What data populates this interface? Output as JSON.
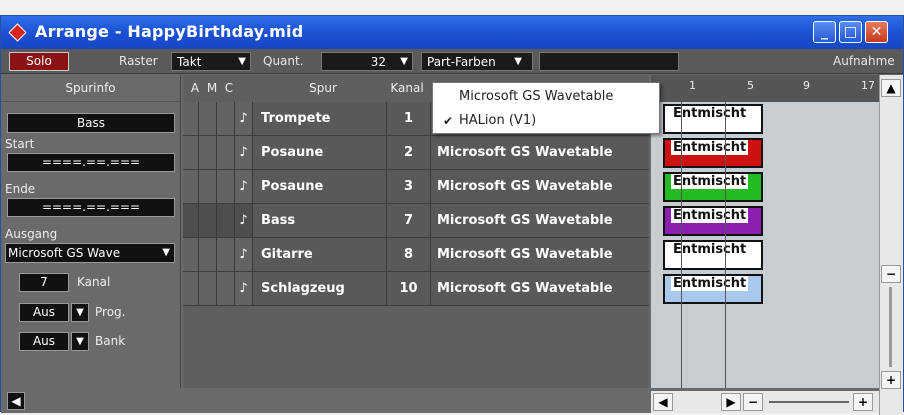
{
  "window": {
    "title": "Arrange - HappyBirthday.mid",
    "minimize": "_",
    "maximize": "□",
    "close": "✕"
  },
  "toolbar": {
    "solo": "Solo",
    "raster_label": "Raster",
    "raster_value": "Takt",
    "quant_label": "Quant.",
    "quant_value": "32",
    "part_colors": "Part-Farben",
    "record_label": "Aufnahme"
  },
  "inspector": {
    "title": "Spurinfo",
    "track_name": "Bass",
    "start_label": "Start",
    "start_value": "====.==.===",
    "end_label": "Ende",
    "end_value": "====.==.===",
    "output_label": "Ausgang",
    "output_value": "Microsoft GS Wave",
    "channel_value": "7",
    "channel_label": "Kanal",
    "prog_value": "Aus",
    "prog_label": "Prog.",
    "bank_value": "Aus",
    "bank_label": "Bank"
  },
  "columns": {
    "a": "A",
    "m": "M",
    "c": "C",
    "track": "Spur",
    "channel": "Kanal"
  },
  "tracks": [
    {
      "name": "Trompete",
      "channel": "1",
      "output": "HALion (V1)",
      "part": "Entmischt",
      "color": "#ffffff"
    },
    {
      "name": "Posaune",
      "channel": "2",
      "output": "Microsoft GS Wavetable",
      "part": "Entmischt",
      "color": "#cc1111"
    },
    {
      "name": "Posaune",
      "channel": "3",
      "output": "Microsoft GS Wavetable",
      "part": "Entmischt",
      "color": "#22bb22"
    },
    {
      "name": "Bass",
      "channel": "7",
      "output": "Microsoft GS Wavetable",
      "part": "Entmischt",
      "color": "#8a1fb0"
    },
    {
      "name": "Gitarre",
      "channel": "8",
      "output": "Microsoft GS Wavetable",
      "part": "Entmischt",
      "color": "#ffffff"
    },
    {
      "name": "Schlagzeug",
      "channel": "10",
      "output": "Microsoft GS Wavetable",
      "part": "Entmischt",
      "color": "#a8c8ee"
    }
  ],
  "ruler": {
    "m1": "1",
    "m5": "5",
    "m9": "9",
    "m17": "17",
    "marker_l": "L",
    "marker_r": "R"
  },
  "dropdown": {
    "items": [
      {
        "label": "Microsoft GS Wavetable",
        "checked": false
      },
      {
        "label": "HALion (V1)",
        "checked": true
      }
    ]
  },
  "icons": {
    "note": "♪",
    "arrow_down": "▼",
    "check": "✔"
  }
}
